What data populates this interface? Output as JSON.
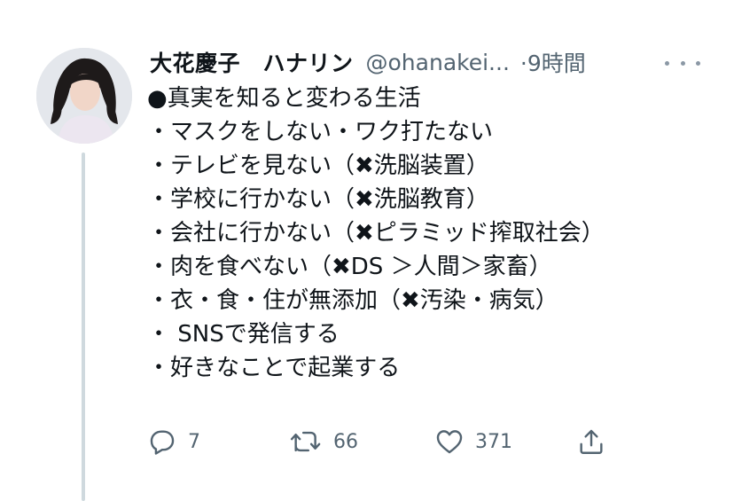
{
  "tweet": {
    "author_name": "大花慶子　ハナリン",
    "handle": "@ohanakei...",
    "time": "·9時間",
    "lines": [
      "●真実を知ると変わる生活",
      "・マスクをしない・ワク打たない",
      "・テレビを見ない（✖洗脳装置）",
      "・学校に行かない（✖洗脳教育）",
      "・会社に行かない（✖ピラミッド搾取社会）",
      "・肉を食べない（✖DS ＞人間＞家畜）",
      "・衣・食・住が無添加（✖汚染・病気）",
      "・ SNSで発信する",
      "・好きなことで起業する"
    ]
  },
  "actions": {
    "reply": {
      "icon": "reply-icon",
      "count": "7"
    },
    "retweet": {
      "icon": "retweet-icon",
      "count": "66"
    },
    "like": {
      "icon": "heart-icon",
      "count": "371"
    },
    "share": {
      "icon": "share-icon"
    }
  },
  "colors": {
    "text": "#0f1419",
    "secondary": "#536471",
    "thread_line": "#cfd9de"
  }
}
